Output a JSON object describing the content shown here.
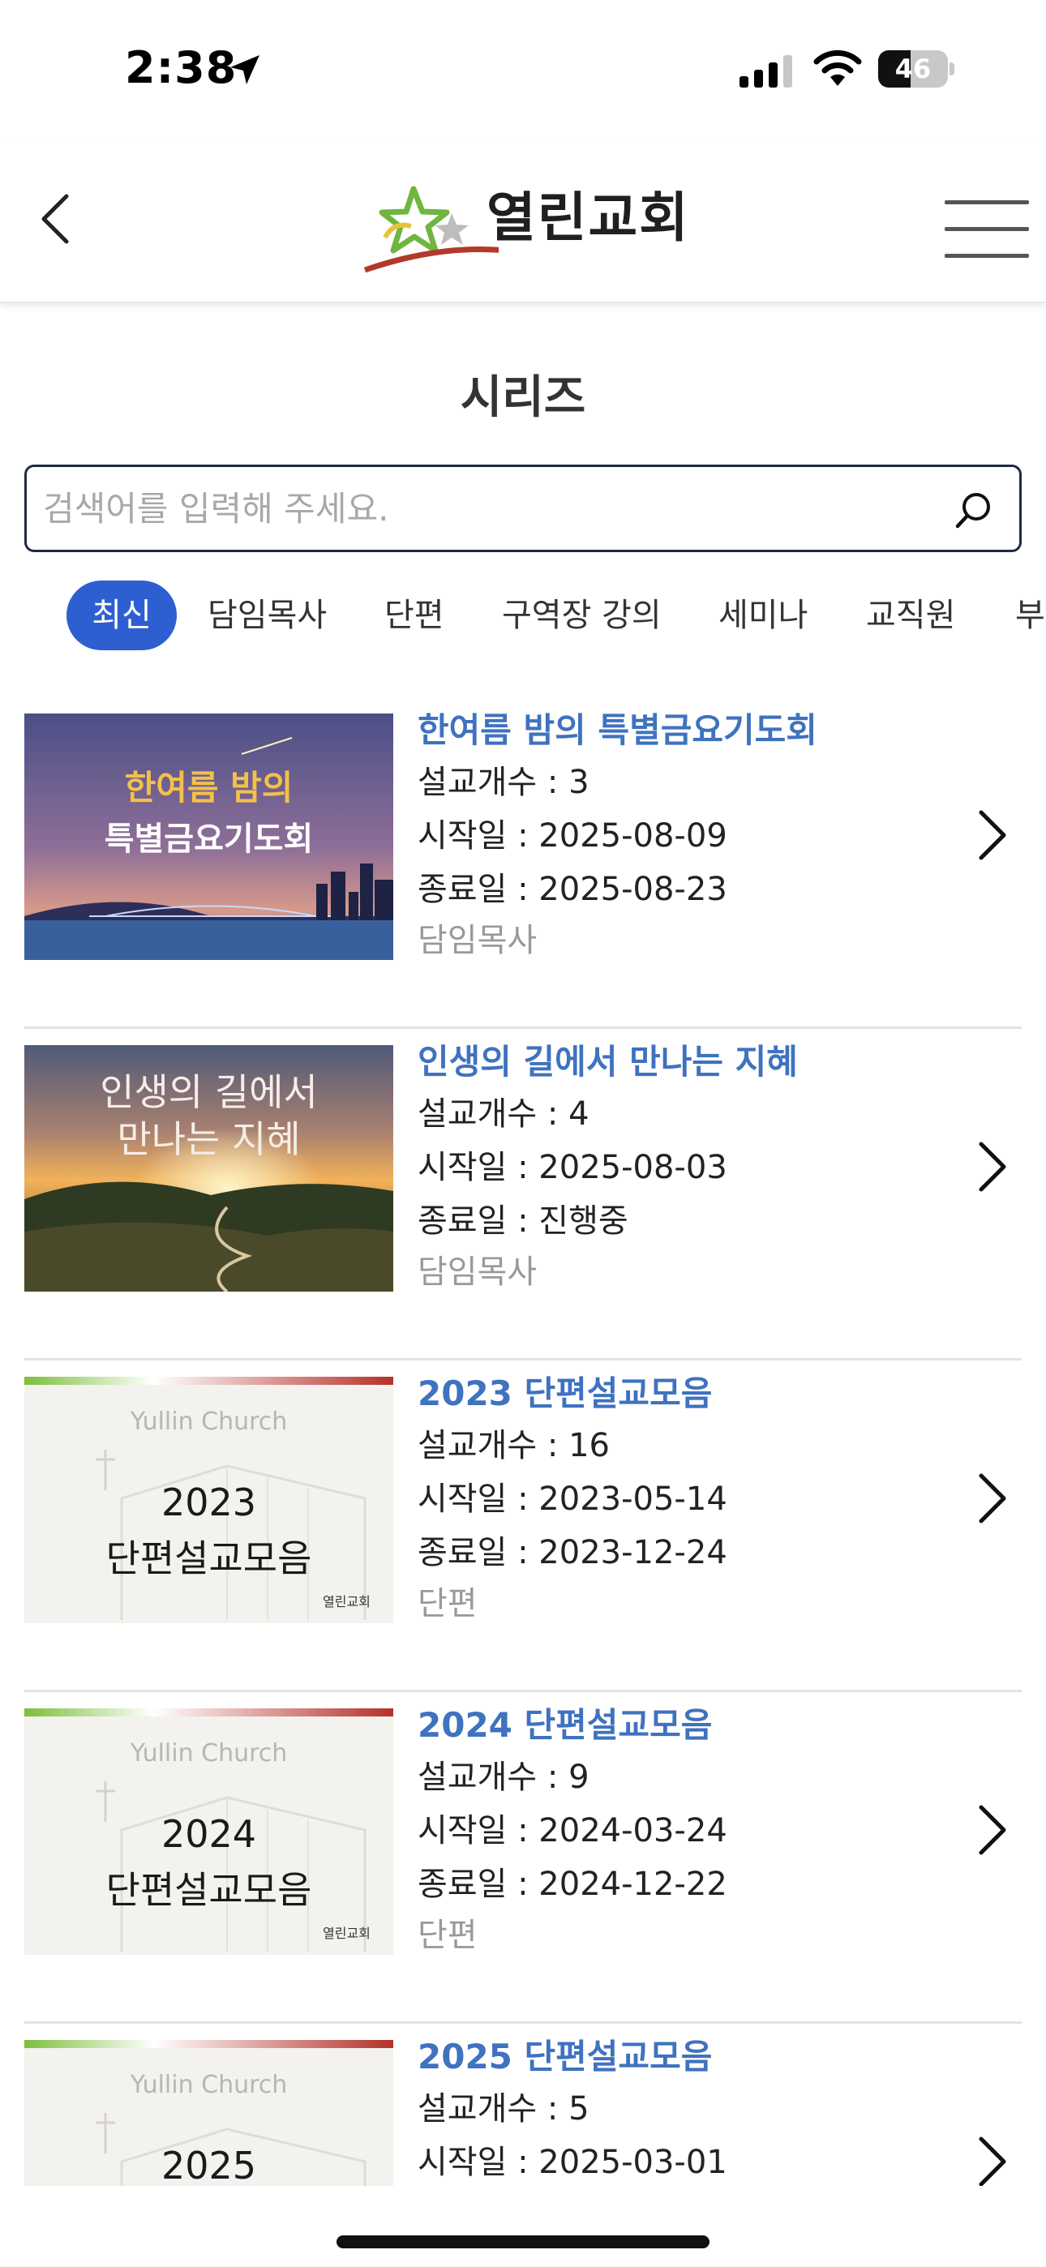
{
  "status_bar": {
    "time": "2:38",
    "battery": "46",
    "battery_level": 0.46,
    "icons": [
      "location-arrow-icon",
      "cellular-signal-icon",
      "wifi-icon",
      "battery-icon"
    ]
  },
  "header": {
    "logo_text": "열린교회",
    "icons": [
      "back-chevron-icon",
      "hamburger-menu-icon"
    ]
  },
  "page": {
    "title": "시리즈"
  },
  "search": {
    "placeholder": "검색어를 입력해 주세요.",
    "value": "",
    "icon": "search-icon"
  },
  "filters": {
    "active_index": 0,
    "items": [
      "최신",
      "담임목사",
      "단편",
      "구역장 강의",
      "세미나",
      "교직원",
      "부"
    ]
  },
  "series": [
    {
      "title": "한여름 밤의 특별금요기도회",
      "count": "설교개수 : 3",
      "start": "시작일 : 2025-08-09",
      "end": "종료일 : 2025-08-23",
      "category": "담임목사",
      "thumb_line1": "한여름 밤의",
      "thumb_line2": "특별금요기도회"
    },
    {
      "title": "인생의 길에서 만나는 지혜",
      "count": "설교개수 : 4",
      "start": "시작일 : 2025-08-03",
      "end": "종료일 : 진행중",
      "category": "담임목사",
      "thumb_line1": "인생의 길에서",
      "thumb_line2": "만나는 지혜"
    },
    {
      "title": "2023 단편설교모음",
      "count": "설교개수 : 16",
      "start": "시작일 : 2023-05-14",
      "end": "종료일 : 2023-12-24",
      "category": "단편",
      "thumb_brand": "Yullin Church",
      "thumb_line1": "2023",
      "thumb_line2": "단편설교모음",
      "thumb_logo": "열린교회"
    },
    {
      "title": "2024 단편설교모음",
      "count": "설교개수 : 9",
      "start": "시작일 : 2024-03-24",
      "end": "종료일 : 2024-12-22",
      "category": "단편",
      "thumb_brand": "Yullin Church",
      "thumb_line1": "2024",
      "thumb_line2": "단편설교모음",
      "thumb_logo": "열린교회"
    },
    {
      "title": "2025 단편설교모음",
      "count": "설교개수 : 5",
      "start": "시작일 : 2025-03-01",
      "thumb_brand": "Yullin Church",
      "thumb_line1": "2025"
    }
  ],
  "colors": {
    "accent": "#2e5fd0",
    "series_title": "#3f72bf",
    "search_border": "#1f2a44"
  }
}
